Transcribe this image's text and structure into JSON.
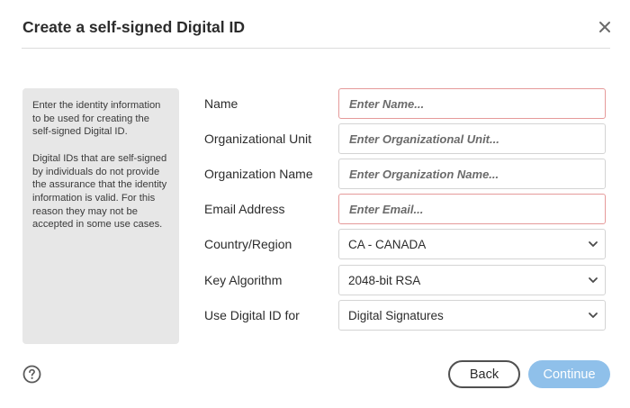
{
  "dialog": {
    "title": "Create a self-signed Digital ID",
    "close_icon": "close-icon"
  },
  "info": {
    "paragraph1": "Enter the identity information to be used for creating the self-signed Digital ID.",
    "paragraph2": "Digital IDs that are self-signed by individuals do not provide the assurance that the identity information is valid. For this reason they may not be accepted in some use cases."
  },
  "form": {
    "name": {
      "label": "Name",
      "value": "",
      "placeholder": "Enter Name..."
    },
    "org_unit": {
      "label": "Organizational Unit",
      "value": "",
      "placeholder": "Enter Organizational Unit..."
    },
    "org_name": {
      "label": "Organization Name",
      "value": "",
      "placeholder": "Enter Organization Name..."
    },
    "email": {
      "label": "Email Address",
      "value": "",
      "placeholder": "Enter Email..."
    },
    "country": {
      "label": "Country/Region",
      "selected": "CA - CANADA"
    },
    "key_algorithm": {
      "label": "Key Algorithm",
      "selected": "2048-bit RSA"
    },
    "use_for": {
      "label": "Use Digital ID for",
      "selected": "Digital Signatures"
    }
  },
  "footer": {
    "help_icon": "help-icon",
    "back_label": "Back",
    "continue_label": "Continue"
  },
  "colors": {
    "required_border": "#e59a9a",
    "continue_bg": "#8fc0ea",
    "info_bg": "#e7e7e7"
  }
}
